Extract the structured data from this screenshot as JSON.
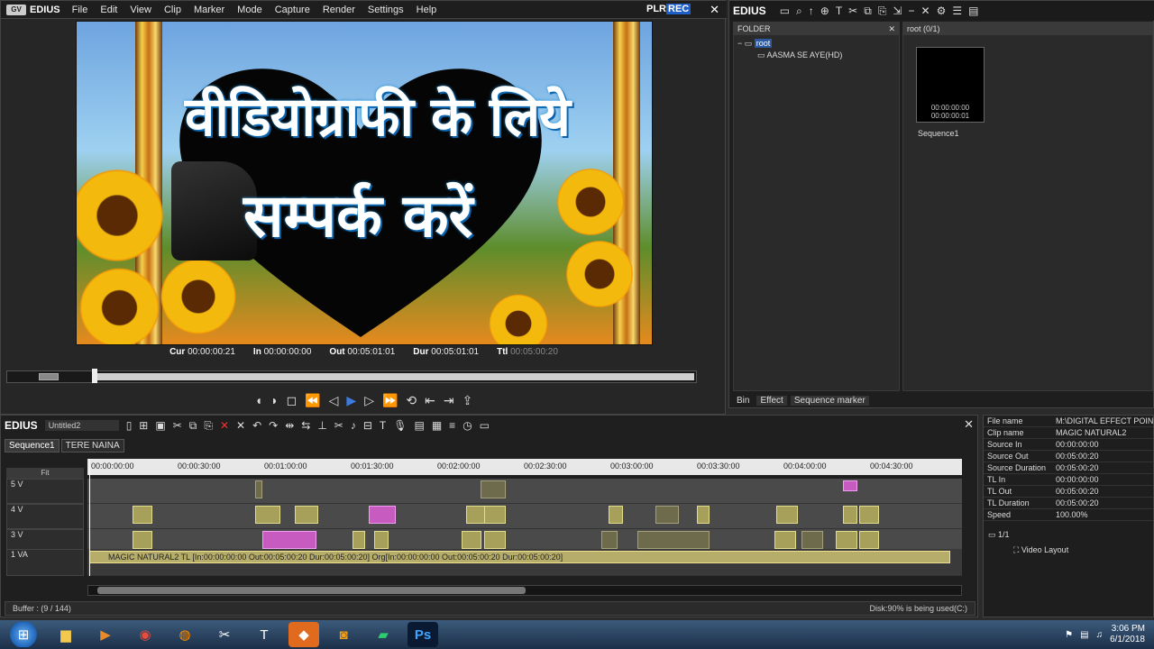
{
  "app": {
    "name": "EDIUS",
    "menu": [
      "File",
      "Edit",
      "View",
      "Clip",
      "Marker",
      "Mode",
      "Capture",
      "Render",
      "Settings",
      "Help"
    ],
    "plr": "PLR",
    "rec": "REC"
  },
  "timecode": {
    "cur_label": "Cur",
    "cur": "00:00:00:21",
    "in_label": "In",
    "in": "00:00:00:00",
    "out_label": "Out",
    "out": "00:05:01:01",
    "dur_label": "Dur",
    "dur": "00:05:01:01",
    "ttl_label": "Ttl",
    "ttl": "00:05:00:20"
  },
  "preview": {
    "line1": "वीडियोग्राफी के लिये",
    "line2": "सम्पर्क करें"
  },
  "bin": {
    "title": "EDIUS",
    "folder_header": "FOLDER",
    "root": "root",
    "child": "AASMA SE AYE(HD)",
    "clips_header": "root (0/1)",
    "clip_name": "Sequence1",
    "clip_tc1": "00:00:00:00",
    "clip_tc2": "00:00:00:01",
    "tabs": [
      "Bin",
      "Effect",
      "Sequence marker"
    ]
  },
  "timeline": {
    "title": "EDIUS",
    "project": "Untitled2",
    "seqtabs": [
      "Sequence1",
      "TERE NAINA"
    ],
    "fit": "Fit",
    "ruler": [
      "00:00:00:00",
      "00:00:30:00",
      "00:01:00:00",
      "00:01:30:00",
      "00:02:00:00",
      "00:02:30:00",
      "00:03:00:00",
      "00:03:30:00",
      "00:04:00:00",
      "00:04:30:00"
    ],
    "tracks": [
      "5 V",
      "4 V",
      "3 V",
      "1 VA"
    ],
    "vaclip": "MAGIC NATURAL2  TL [In:00:00:00:00 Out:00:05:00:20 Dur:00:05:00:20]  Org[In:00:00:00:00 Out:00:05:00:20 Dur:00:05:00:20]",
    "buffer": "Buffer : (9 / 144)",
    "disk": "Disk:90% is being used(C:)"
  },
  "info": [
    [
      "File name",
      "M:\\DIGITAL EFFECT POINT"
    ],
    [
      "Clip name",
      "MAGIC NATURAL2"
    ],
    [
      "Source In",
      "00:00:00:00"
    ],
    [
      "Source Out",
      "00:05:00:20"
    ],
    [
      "Source Duration",
      "00:05:00:20"
    ],
    [
      "TL In",
      "00:00:00:00"
    ],
    [
      "TL Out",
      "00:05:00:20"
    ],
    [
      "TL Duration",
      "00:05:00:20"
    ],
    [
      "Speed",
      "100.00%"
    ]
  ],
  "layout": {
    "page": "1/1",
    "item": "Video Layout"
  },
  "taskbar": {
    "time": "3:06 PM",
    "date": "6/1/2018",
    "ps": "Ps"
  }
}
